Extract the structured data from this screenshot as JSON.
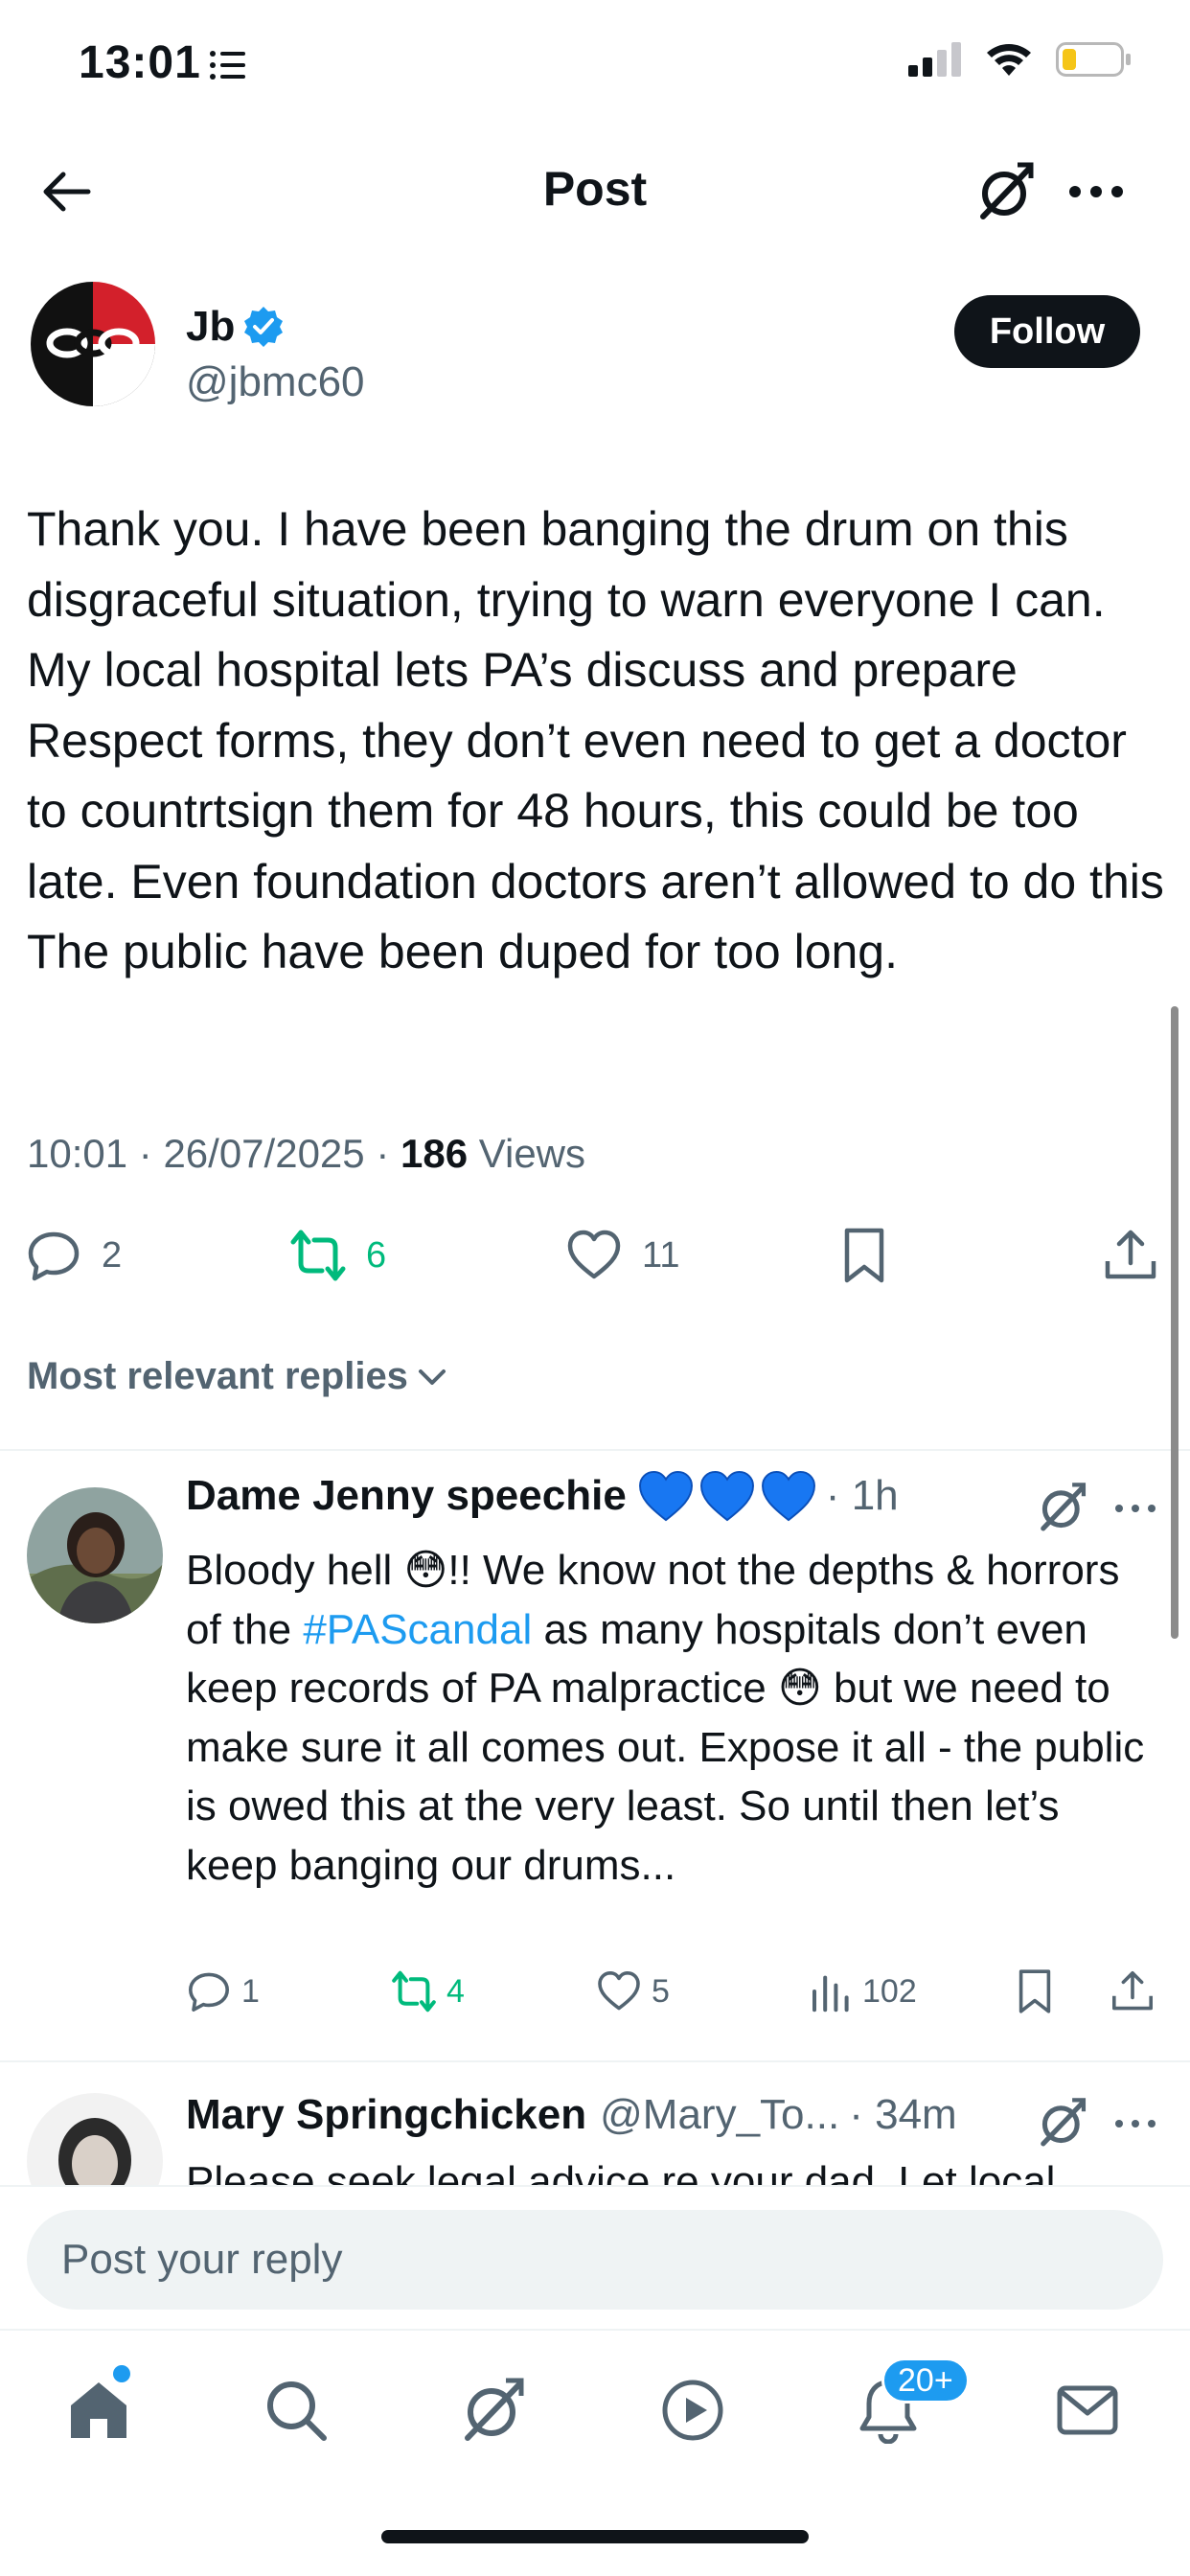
{
  "status": {
    "time": "13:01"
  },
  "nav": {
    "title": "Post"
  },
  "tweet": {
    "author_name": "Jb",
    "handle": "@jbmc60",
    "follow_label": "Follow",
    "text": "Thank you. I have been banging the drum on this disgraceful situation, trying to warn everyone I can. My local hospital lets PA’s discuss and prepare Respect forms, they don’t even need to get a doctor to countrtsign them for 48 hours, this could be too late. Even foundation doctors aren’t allowed to do this The public have been duped for too long.",
    "time": "10:01",
    "date": "26/07/2025",
    "views_count": "186",
    "views_label": "Views",
    "replies": "2",
    "reposts": "6",
    "likes": "11"
  },
  "sort_label": "Most relevant replies",
  "replies": [
    {
      "name": "Dame Jenny speechie",
      "handle": "",
      "time": "1h",
      "text_parts": [
        "Bloody hell ",
        "😳",
        "!! We know not the depths & horrors of the ",
        "#PAScandal",
        " as many hospitals don’t even keep records of PA malpractice ",
        "😳",
        " but we need to make sure it all comes out. Expose it all - the public is owed this at the very least. So until then let’s keep banging our drums..."
      ],
      "replies": "1",
      "reposts": "4",
      "likes": "5",
      "views": "102"
    },
    {
      "name": "Mary Springchicken",
      "handle": "@Mary_To...",
      "time": "34m",
      "text": "Please seek legal advice re your dad. Let local"
    }
  ],
  "compose": {
    "placeholder": "Post your reply"
  },
  "tabs": {
    "notifications_badge": "20+"
  },
  "colors": {
    "accent": "#1d9bf0",
    "repost": "#00ba7c",
    "muted": "#536471",
    "text": "#0f1419"
  }
}
